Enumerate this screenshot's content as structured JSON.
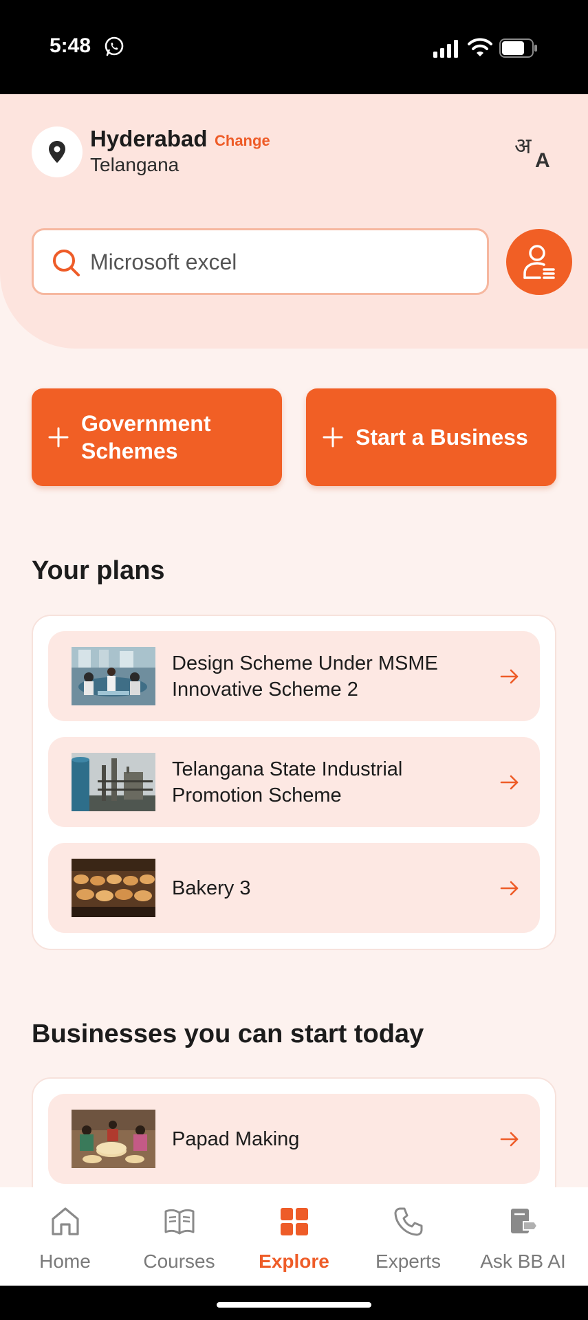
{
  "status_bar": {
    "time": "5:48"
  },
  "location": {
    "city": "Hyderabad",
    "change_label": "Change",
    "state": "Telangana"
  },
  "search": {
    "value": "Microsoft excel"
  },
  "actions": [
    {
      "label": "Government Schemes"
    },
    {
      "label": "Start a Business"
    }
  ],
  "plans": {
    "title": "Your plans",
    "items": [
      {
        "label": "Design Scheme Under MSME Innovative Scheme 2"
      },
      {
        "label": "Telangana State Industrial Promotion Scheme"
      },
      {
        "label": "Bakery 3"
      }
    ]
  },
  "businesses": {
    "title": "Businesses you can start today",
    "items": [
      {
        "label": "Papad Making"
      }
    ]
  },
  "bottom_nav": [
    {
      "label": "Home",
      "icon": "home-icon"
    },
    {
      "label": "Courses",
      "icon": "book-icon"
    },
    {
      "label": "Explore",
      "icon": "grid-icon",
      "active": true
    },
    {
      "label": "Experts",
      "icon": "phone-icon"
    },
    {
      "label": "Ask BB AI",
      "icon": "ai-icon"
    }
  ],
  "colors": {
    "accent": "#F15F25",
    "background": "#FDF2EF",
    "row_background": "#FDE8E3"
  }
}
